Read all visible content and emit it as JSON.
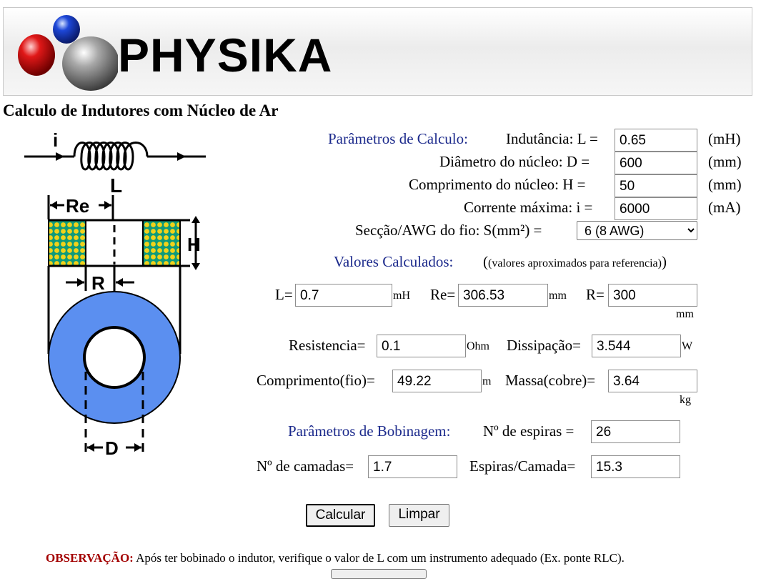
{
  "header": {
    "logo_text": "PHYSIKA"
  },
  "page": {
    "title": "Calculo de Indutores com Núcleo de Ar"
  },
  "diagram": {
    "label_i": "i",
    "label_L": "L",
    "label_Re": "Re",
    "label_H": "H",
    "label_R": "R",
    "label_D": "D"
  },
  "params": {
    "section_label": "Parâmetros de Calculo:",
    "inductance": {
      "label": "Indutância: L =",
      "value": "0.65",
      "unit": "(mH)"
    },
    "diameter": {
      "label": "Diâmetro do núcleo: D =",
      "value": "600",
      "unit": "(mm)"
    },
    "length": {
      "label": "Comprimento do núcleo: H =",
      "value": "50",
      "unit": "(mm)"
    },
    "current": {
      "label": "Corrente máxima: i =",
      "value": "6000",
      "unit": "(mA)"
    },
    "wire": {
      "label": "Secção/AWG do fio: S(mm²) =",
      "selected": "6 (8 AWG)"
    }
  },
  "calculated": {
    "section_label": "Valores Calculados:",
    "note": "(valores aproximados para referencia)",
    "L": {
      "label": "L=",
      "value": "0.7",
      "unit": "mH"
    },
    "Re": {
      "label": "Re=",
      "value": "306.53",
      "unit": "mm"
    },
    "R": {
      "label": "R=",
      "value": "300",
      "unit": "mm"
    },
    "resistance": {
      "label": "Resistencia=",
      "value": "0.1",
      "unit": "Ohm"
    },
    "dissipation": {
      "label": "Dissipação=",
      "value": "3.544",
      "unit": "W"
    },
    "wire_length": {
      "label": "Comprimento(fio)=",
      "value": "49.22",
      "unit": "m"
    },
    "mass": {
      "label": "Massa(cobre)=",
      "value": "3.64",
      "unit": "kg"
    }
  },
  "winding": {
    "section_label": "Parâmetros de Bobinagem:",
    "turns": {
      "label": "Nº de espiras =",
      "value": "26"
    },
    "layers": {
      "label": "Nº de camadas=",
      "value": "1.7"
    },
    "turns_per_layer": {
      "label": "Espiras/Camada=",
      "value": "15.3"
    }
  },
  "buttons": {
    "calculate": "Calcular",
    "clear": "Limpar"
  },
  "footer": {
    "obs_label": "OBSERVAÇÃO:",
    "obs_text": " Após ter bobinado o indutor, verifique o valor de L com um instrumento adequado (Ex. ponte RLC)."
  },
  "colors": {
    "core_blue": "#5b8ff0",
    "winding_green": "#0f9a7a",
    "winding_dot_yellow": "#f2d21a",
    "label_blue": "#1c2a8c",
    "obs_red": "#a30000"
  }
}
